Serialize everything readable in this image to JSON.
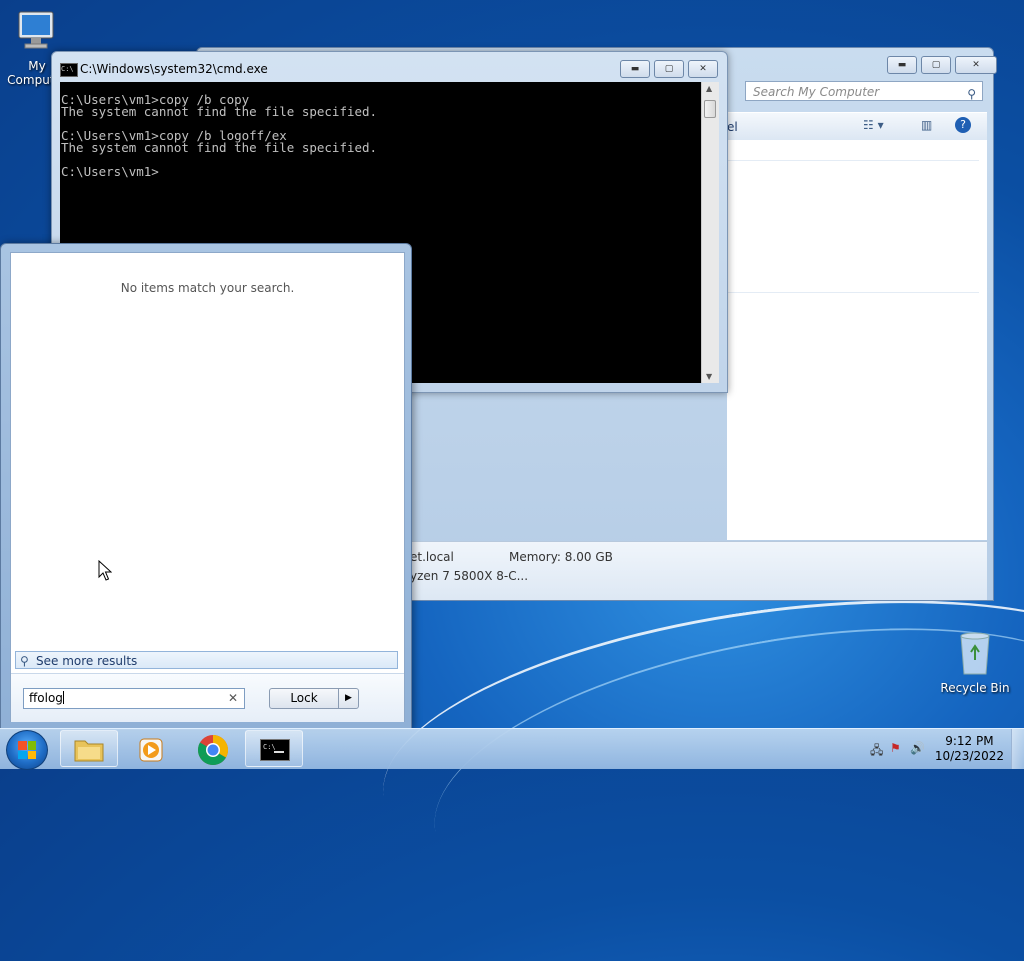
{
  "desktop": {
    "icons": [
      {
        "label": "My Computer"
      },
      {
        "label": "Recycle Bin"
      }
    ]
  },
  "explorer": {
    "search_placeholder": "Search My Computer",
    "toolbar_fragment": "el",
    "details": {
      "domain_fragment": "et.local",
      "memory": "Memory: 8.00 GB",
      "processor_fragment": "yzen 7 5800X 8-C..."
    }
  },
  "cmd": {
    "title": "C:\\Windows\\system32\\cmd.exe",
    "lines": [
      "C:\\Users\\vm1>copy /b copy",
      "The system cannot find the file specified.",
      "",
      "C:\\Users\\vm1>copy /b logoff/ex",
      "The system cannot find the file specified.",
      "",
      "C:\\Users\\vm1>"
    ]
  },
  "start_menu": {
    "no_items": "No items match your search.",
    "see_more": "See more results",
    "search_value": "ffolog",
    "lock_label": "Lock"
  },
  "taskbar": {
    "time": "9:12 PM",
    "date": "10/23/2022"
  },
  "colors": {
    "desktop": "#0b4fa3",
    "cmd_bg": "#000000",
    "cmd_text": "#c0c0c0"
  }
}
